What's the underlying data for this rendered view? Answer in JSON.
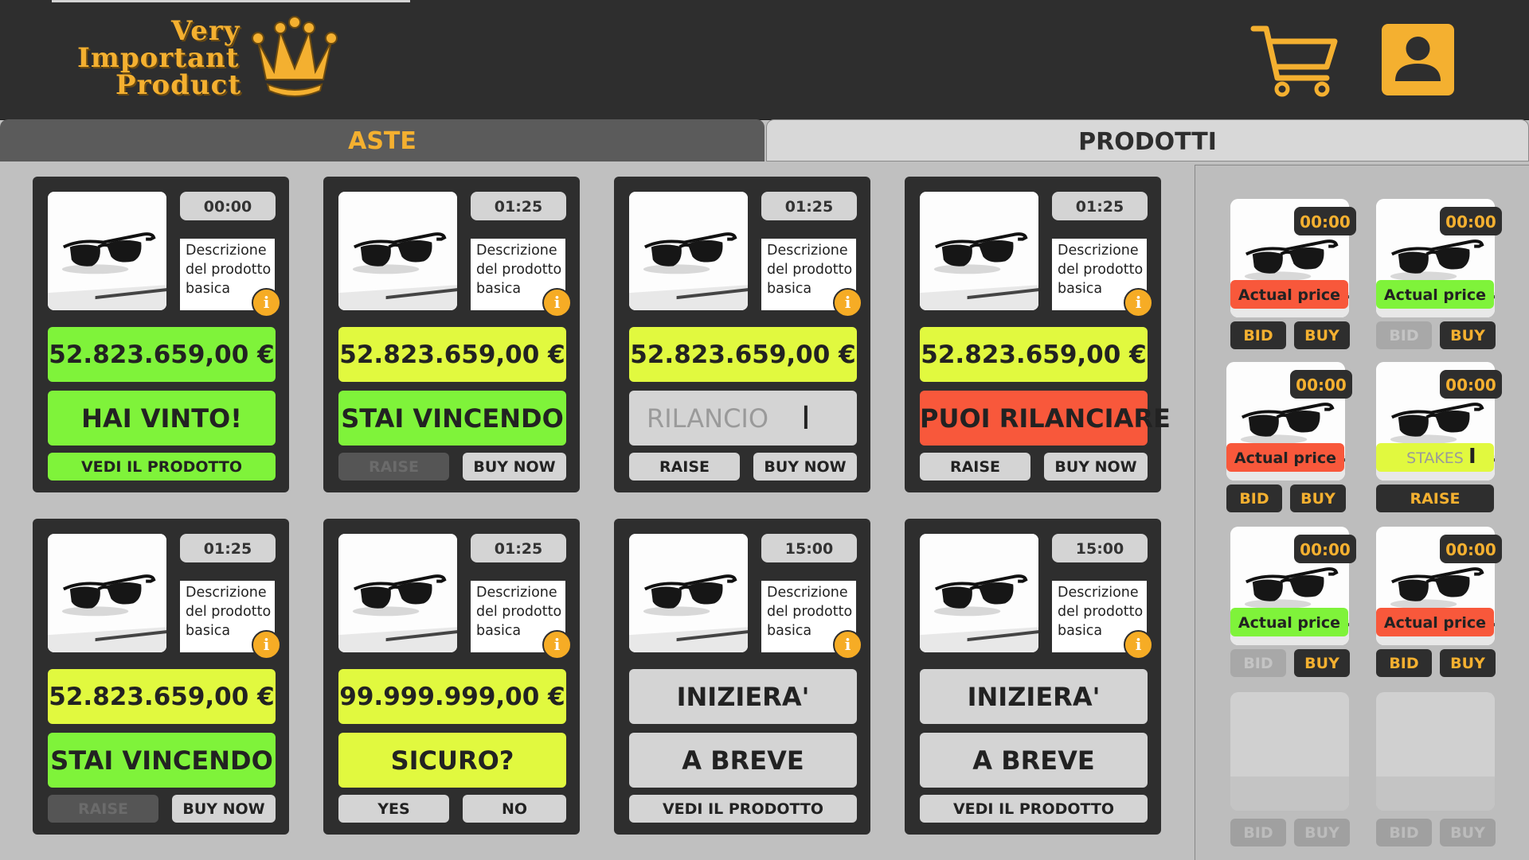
{
  "header": {
    "logo_lines": [
      "Very",
      "Important",
      "Product"
    ],
    "cart_icon": "cart-icon",
    "user_icon": "user-icon",
    "accent": "#f4b030"
  },
  "tabs": [
    {
      "label": "ASTE",
      "active": true
    },
    {
      "label": "PRODOTTI",
      "active": false
    }
  ],
  "auctions": [
    {
      "timer": "00:00",
      "desc": [
        "Descrizione",
        "del prodotto",
        "basica"
      ],
      "price": "52.823.659,00 €",
      "price_color": "green",
      "status": "HAI VINTO!",
      "status_color": "green",
      "button_full": "VEDI IL PRODOTTO"
    },
    {
      "timer": "01:25",
      "desc": [
        "Descrizione",
        "del prodotto",
        "basica"
      ],
      "price": "52.823.659,00 €",
      "price_color": "yellow",
      "status": "STAI VINCENDO",
      "status_color": "green",
      "left_button": "RAISE",
      "right_button": "BUY NOW"
    },
    {
      "timer": "01:25",
      "desc": [
        "Descrizione",
        "del prodotto",
        "basica"
      ],
      "price": "52.823.659,00 €",
      "price_color": "yellow",
      "status": "RILANCIO",
      "status_color": "gray",
      "left_button": "RAISE",
      "right_button": "BUY NOW"
    },
    {
      "timer": "01:25",
      "desc": [
        "Descrizione",
        "del prodotto",
        "basica"
      ],
      "price": "52.823.659,00 €",
      "price_color": "yellow",
      "status": "PUOI RILANCIARE",
      "status_color": "red",
      "left_button": "RAISE",
      "right_button": "BUY NOW"
    },
    {
      "timer": "01:25",
      "desc": [
        "Descrizione",
        "del prodotto",
        "basica"
      ],
      "price": "52.823.659,00 €",
      "price_color": "yellow",
      "status": "STAI VINCENDO",
      "status_color": "green",
      "left_button": "RAISE",
      "right_button": "BUY NOW"
    },
    {
      "timer": "01:25",
      "desc": [
        "Descrizione",
        "del prodotto",
        "basica"
      ],
      "price": "99.999.999,00 €",
      "price_color": "yellow",
      "status": "SICURO?",
      "status_color": "yellow",
      "left_button": "YES",
      "right_button": "NO"
    },
    {
      "timer": "15:00",
      "desc": [
        "Descrizione",
        "del prodotto",
        "basica"
      ],
      "price": "INIZIERA'",
      "price_color": "gray",
      "status": "A BREVE",
      "status_color": "gray",
      "button_full": "VEDI IL PRODOTTO"
    },
    {
      "timer": "15:00",
      "desc": [
        "Descrizione",
        "del prodotto",
        "basica"
      ],
      "price": "INIZIERA'",
      "price_color": "gray",
      "status": "A BREVE",
      "status_color": "gray",
      "button_full": "VEDI IL PRODOTTO"
    }
  ],
  "side_items": [
    {
      "timer": "00:00",
      "price_label": "Actual price",
      "price_color": "red",
      "buttons": [
        "BID",
        "BUY"
      ]
    },
    {
      "timer": "00:00",
      "price_label": "Actual price",
      "price_color": "green",
      "buttons": [
        "BID",
        "BUY"
      ]
    },
    {
      "timer": "00:00",
      "price_label": "Actual price",
      "price_color": "red",
      "buttons": [
        "BID",
        "BUY"
      ]
    },
    {
      "timer": "00:00",
      "price_label": "STAKES",
      "price_color": "yellow",
      "buttons": [
        "RAISE"
      ]
    },
    {
      "timer": "00:00",
      "price_label": "Actual price",
      "price_color": "green",
      "buttons": [
        "BID",
        "BUY"
      ]
    },
    {
      "timer": "00:00",
      "price_label": "Actual price",
      "price_color": "red",
      "buttons": [
        "BID",
        "BUY"
      ]
    },
    {
      "buttons": [
        "BID",
        "BUY"
      ]
    },
    {
      "buttons": [
        "BID",
        "BUY"
      ]
    }
  ],
  "colors": {
    "green": "#7ff33a",
    "yellow": "#e1f93f",
    "red": "#f8583b",
    "gray": "#d4d4d4",
    "card": "#2e2e2e"
  }
}
